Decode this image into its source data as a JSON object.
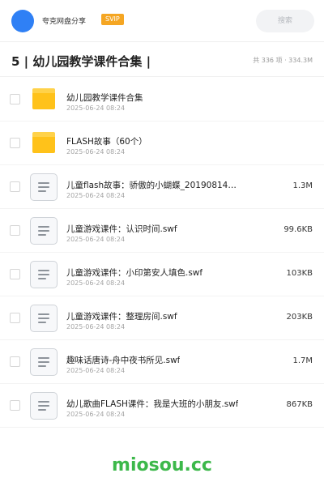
{
  "header": {
    "share_name": "夸克网盘分享",
    "badge": "SVIP",
    "search_placeholder": "搜索",
    "accent_color": "#2f80f5"
  },
  "folder": {
    "title": "5 | 幼儿园教学课件合集 |",
    "summary": "共 336 项 · 334.3M"
  },
  "files": [
    {
      "type": "folder",
      "icon": "folder-icon",
      "name": "幼儿园教学课件合集",
      "date": "2025-06-24 08:24",
      "size": ""
    },
    {
      "type": "folder",
      "icon": "folder-icon",
      "name": "FLASH故事（60个）",
      "date": "2025-06-24 08:24",
      "size": ""
    },
    {
      "type": "file",
      "icon": "document-icon",
      "name": "儿童flash故事：骄傲的小蝴蝶_20190814…",
      "date": "2025-06-24 08:24",
      "size": "1.3M"
    },
    {
      "type": "file",
      "icon": "document-icon",
      "name": "儿童游戏课件：认识时间.swf",
      "date": "2025-06-24 08:24",
      "size": "99.6KB"
    },
    {
      "type": "file",
      "icon": "document-icon",
      "name": "儿童游戏课件：小印第安人填色.swf",
      "date": "2025-06-24 08:24",
      "size": "103KB"
    },
    {
      "type": "file",
      "icon": "document-icon",
      "name": "儿童游戏课件：整理房间.swf",
      "date": "2025-06-24 08:24",
      "size": "203KB"
    },
    {
      "type": "file",
      "icon": "document-icon",
      "name": "趣味话唐诗-舟中夜书所见.swf",
      "date": "2025-06-24 08:24",
      "size": "1.7M"
    },
    {
      "type": "file",
      "icon": "document-icon",
      "name": "幼儿歌曲FLASH课件：我是大班的小朋友.swf",
      "date": "2025-06-24 08:24",
      "size": "867KB"
    }
  ],
  "watermark": "miosou.cc"
}
